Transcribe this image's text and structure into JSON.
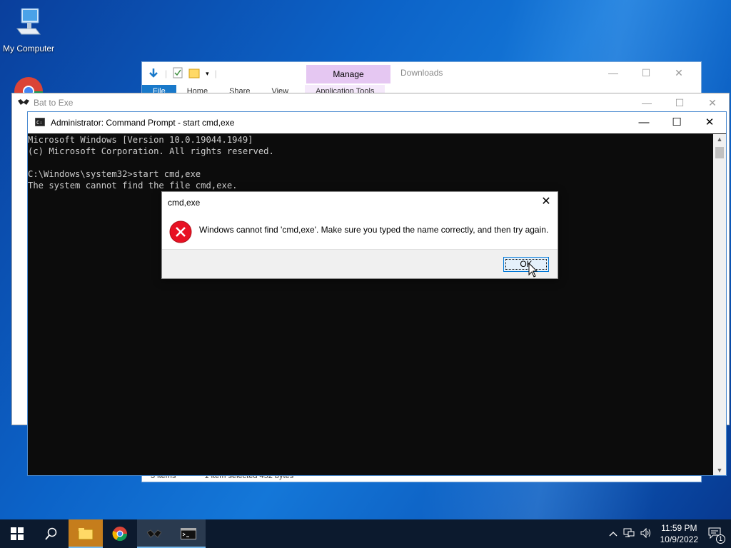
{
  "desktop": {
    "icons": [
      {
        "label": "My Computer"
      }
    ]
  },
  "explorer": {
    "manage_label": "Manage",
    "title": "Downloads",
    "tabs": [
      "File",
      "Home",
      "Share",
      "View",
      "Application Tools"
    ],
    "status_items": "3 items",
    "status_selected": "1 item selected  452 bytes"
  },
  "bat_window": {
    "title": "Bat to Exe"
  },
  "cmd_window": {
    "title": "Administrator: Command Prompt - start  cmd,exe",
    "console_text": "Microsoft Windows [Version 10.0.19044.1949]\n(c) Microsoft Corporation. All rights reserved.\n\nC:\\Windows\\system32>start cmd,exe\nThe system cannot find the file cmd,exe."
  },
  "dialog": {
    "title": "cmd,exe",
    "message": "Windows cannot find 'cmd,exe'. Make sure you typed the name correctly, and then try again.",
    "ok_label": "OK"
  },
  "taskbar": {
    "time": "11:59 PM",
    "date": "10/9/2022",
    "notification_count": "1"
  },
  "colors": {
    "accent": "#0078d7",
    "error_red": "#e81123",
    "console_bg": "#0c0c0c",
    "taskbar_bg": "#0c1a2e"
  }
}
